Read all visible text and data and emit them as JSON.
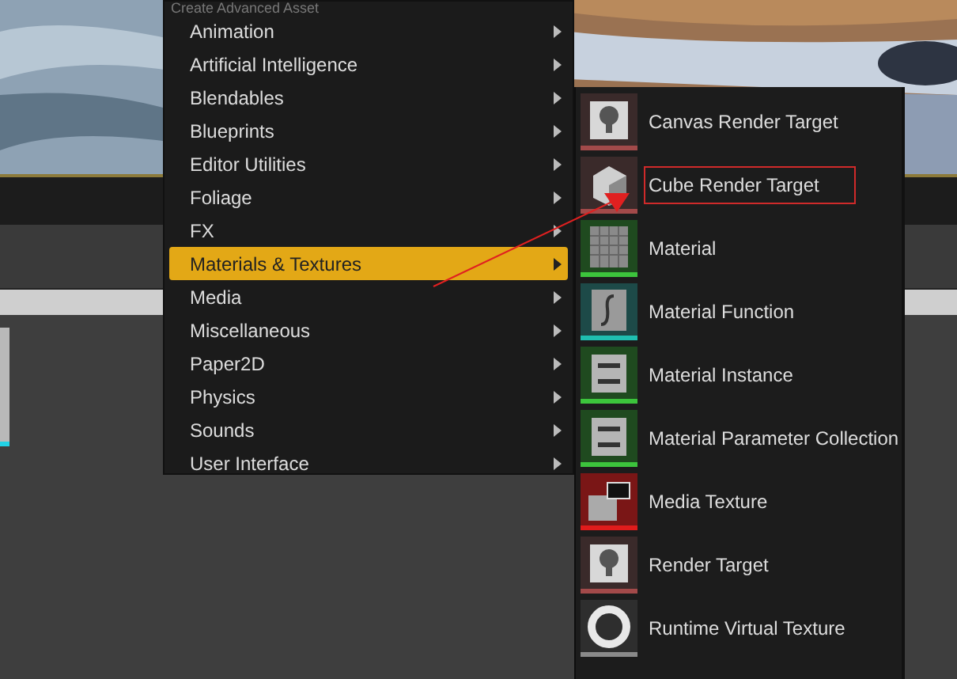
{
  "menu": {
    "header": "Create Advanced Asset",
    "items": [
      {
        "label": "Animation",
        "selected": false
      },
      {
        "label": "Artificial Intelligence",
        "selected": false
      },
      {
        "label": "Blendables",
        "selected": false
      },
      {
        "label": "Blueprints",
        "selected": false
      },
      {
        "label": "Editor Utilities",
        "selected": false
      },
      {
        "label": "Foliage",
        "selected": false
      },
      {
        "label": "FX",
        "selected": false
      },
      {
        "label": "Materials & Textures",
        "selected": true
      },
      {
        "label": "Media",
        "selected": false
      },
      {
        "label": "Miscellaneous",
        "selected": false
      },
      {
        "label": "Paper2D",
        "selected": false
      },
      {
        "label": "Physics",
        "selected": false
      },
      {
        "label": "Sounds",
        "selected": false
      },
      {
        "label": "User Interface",
        "selected": false
      }
    ]
  },
  "submenu": {
    "items": [
      {
        "label": "Canvas Render Target",
        "kind": "render-target",
        "color": "#a34a4a",
        "annotated": false
      },
      {
        "label": "Cube Render Target",
        "kind": "cube",
        "color": "#a34a4a",
        "annotated": true
      },
      {
        "label": "Material",
        "kind": "material",
        "color": "#3cc43c",
        "annotated": false
      },
      {
        "label": "Material Function",
        "kind": "function",
        "color": "#1fbfb0",
        "annotated": false
      },
      {
        "label": "Material Instance",
        "kind": "instance",
        "color": "#3cc43c",
        "annotated": false
      },
      {
        "label": "Material Parameter Collection",
        "kind": "collection",
        "color": "#3cc43c",
        "annotated": false
      },
      {
        "label": "Media Texture",
        "kind": "media",
        "color": "#e01c1c",
        "annotated": false
      },
      {
        "label": "Render Target",
        "kind": "render-target",
        "color": "#a34a4a",
        "annotated": false
      },
      {
        "label": "Runtime Virtual Texture",
        "kind": "ring",
        "color": "#8a8a8a",
        "annotated": false
      }
    ]
  }
}
